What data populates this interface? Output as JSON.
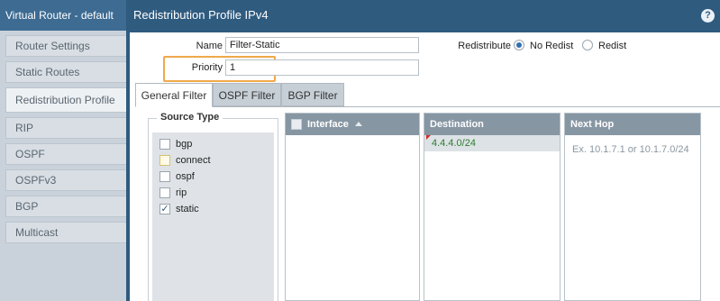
{
  "sidebar": {
    "title": "Virtual Router - default",
    "items": [
      {
        "label": "Router Settings",
        "active": false
      },
      {
        "label": "Static Routes",
        "active": false
      },
      {
        "label": "Redistribution Profile",
        "active": true
      },
      {
        "label": "RIP",
        "active": false
      },
      {
        "label": "OSPF",
        "active": false
      },
      {
        "label": "OSPFv3",
        "active": false
      },
      {
        "label": "BGP",
        "active": false
      },
      {
        "label": "Multicast",
        "active": false
      }
    ]
  },
  "dialog": {
    "title": "Redistribution Profile IPv4",
    "help_glyph": "?",
    "name_label": "Name",
    "name_value": "Filter-Static",
    "priority_label": "Priority",
    "priority_value": "1",
    "redistribute_label": "Redistribute",
    "redistribute_options": [
      {
        "label": "No Redist",
        "selected": true
      },
      {
        "label": "Redist",
        "selected": false
      }
    ],
    "tabs": [
      {
        "label": "General Filter",
        "active": true
      },
      {
        "label": "OSPF Filter",
        "active": false
      },
      {
        "label": "BGP Filter",
        "active": false
      }
    ],
    "source_type": {
      "legend": "Source Type",
      "items": [
        {
          "label": "bgp",
          "checked": false
        },
        {
          "label": "connect",
          "checked": false
        },
        {
          "label": "ospf",
          "checked": false
        },
        {
          "label": "rip",
          "checked": false
        },
        {
          "label": "static",
          "checked": true
        }
      ],
      "check_glyph": "✓"
    },
    "interface_table": {
      "header": "Interface"
    },
    "destination_table": {
      "header": "Destination",
      "rows": [
        "4.4.4.0/24"
      ]
    },
    "nexthop_table": {
      "header": "Next Hop",
      "placeholder": "Ex. 10.1.7.1 or 10.1.7.0/24"
    }
  },
  "colors": {
    "header_blue": "#2f5b7f",
    "highlight_orange": "#f0a94a",
    "table_header": "#8796a3",
    "value_green": "#2e7d2e"
  }
}
